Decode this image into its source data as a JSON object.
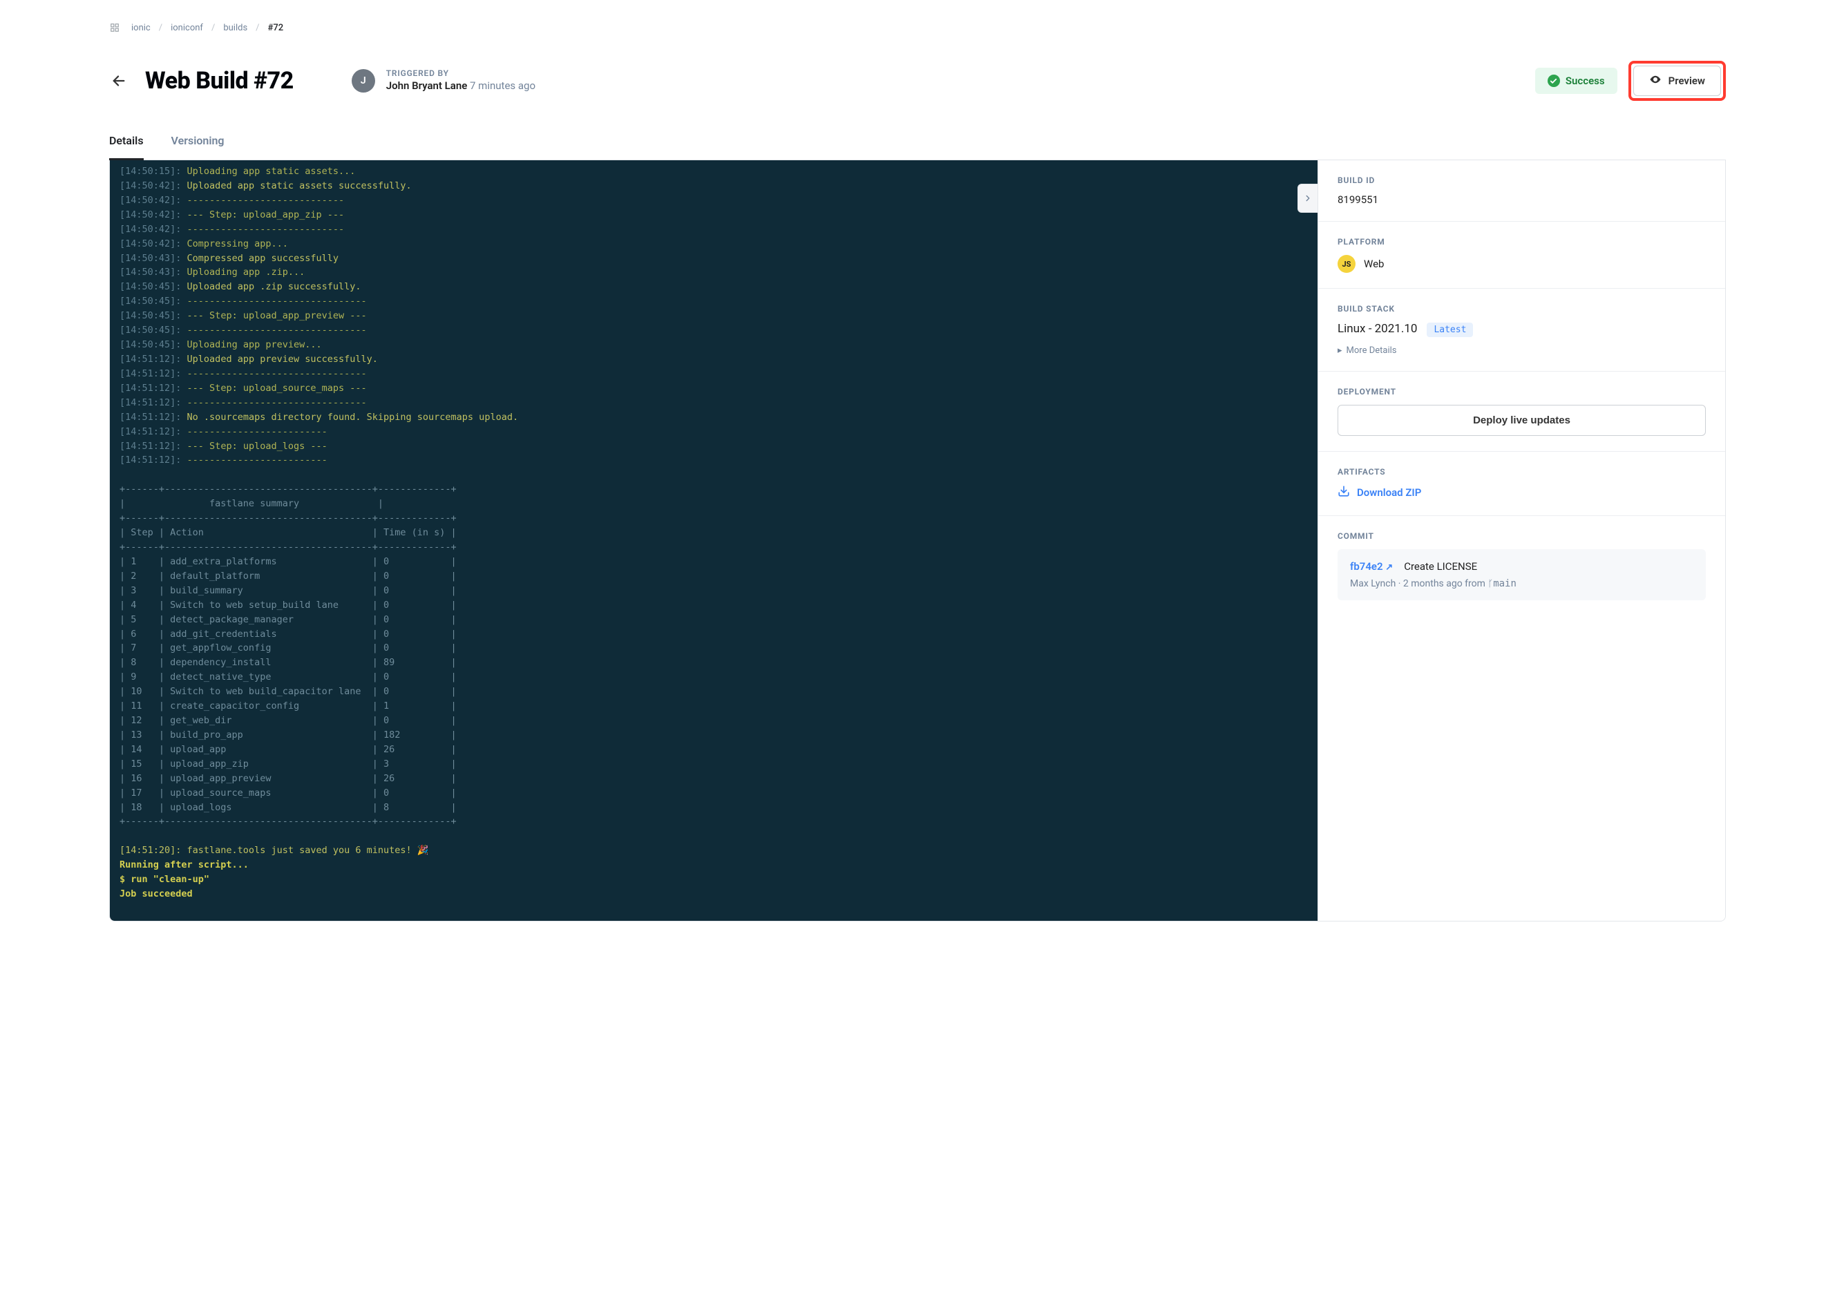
{
  "breadcrumb": {
    "org": "ionic",
    "project": "ioniconf",
    "section": "builds",
    "current": "#72"
  },
  "header": {
    "title": "Web Build #72",
    "triggered_by_label": "TRIGGERED BY",
    "triggered_by_name": "John Bryant Lane",
    "triggered_by_ago": "7 minutes ago",
    "avatar_initial": "J",
    "status": "Success",
    "preview_label": "Preview"
  },
  "tabs": {
    "details": "Details",
    "versioning": "Versioning"
  },
  "console": {
    "lines": [
      {
        "ts": "[14:50:15]:",
        "text": "Uploading app static assets...",
        "cls": "step"
      },
      {
        "ts": "[14:50:42]:",
        "text": "Uploaded app static assets successfully.",
        "cls": "ok"
      },
      {
        "ts": "[14:50:42]:",
        "text": "----------------------------",
        "cls": "dash"
      },
      {
        "ts": "[14:50:42]:",
        "text": "--- Step: upload_app_zip ---",
        "cls": "step"
      },
      {
        "ts": "[14:50:42]:",
        "text": "----------------------------",
        "cls": "dash"
      },
      {
        "ts": "[14:50:42]:",
        "text": "Compressing app...",
        "cls": "step"
      },
      {
        "ts": "[14:50:43]:",
        "text": "Compressed app successfully",
        "cls": "ok"
      },
      {
        "ts": "[14:50:43]:",
        "text": "Uploading app .zip...",
        "cls": "step"
      },
      {
        "ts": "[14:50:45]:",
        "text": "Uploaded app .zip successfully.",
        "cls": "ok"
      },
      {
        "ts": "[14:50:45]:",
        "text": "--------------------------------",
        "cls": "dash"
      },
      {
        "ts": "[14:50:45]:",
        "text": "--- Step: upload_app_preview ---",
        "cls": "step"
      },
      {
        "ts": "[14:50:45]:",
        "text": "--------------------------------",
        "cls": "dash"
      },
      {
        "ts": "[14:50:45]:",
        "text": "Uploading app preview...",
        "cls": "step"
      },
      {
        "ts": "[14:51:12]:",
        "text": "Uploaded app preview successfully.",
        "cls": "ok"
      },
      {
        "ts": "[14:51:12]:",
        "text": "--------------------------------",
        "cls": "dash"
      },
      {
        "ts": "[14:51:12]:",
        "text": "--- Step: upload_source_maps ---",
        "cls": "step"
      },
      {
        "ts": "[14:51:12]:",
        "text": "--------------------------------",
        "cls": "dash"
      },
      {
        "ts": "[14:51:12]:",
        "text": "No .sourcemaps directory found. Skipping sourcemaps upload.",
        "cls": "ok"
      },
      {
        "ts": "[14:51:12]:",
        "text": "-------------------------",
        "cls": "dash"
      },
      {
        "ts": "[14:51:12]:",
        "text": "--- Step: upload_logs ---",
        "cls": "step"
      },
      {
        "ts": "[14:51:12]:",
        "text": "-------------------------",
        "cls": "dash"
      }
    ],
    "summary_title": "fastlane summary",
    "summary_header": {
      "step": "Step",
      "action": "Action",
      "time": "Time (in s)"
    },
    "summary_rows": [
      {
        "n": "1",
        "action": "add_extra_platforms",
        "t": "0"
      },
      {
        "n": "2",
        "action": "default_platform",
        "t": "0"
      },
      {
        "n": "3",
        "action": "build_summary",
        "t": "0"
      },
      {
        "n": "4",
        "action": "Switch to web setup_build lane",
        "t": "0"
      },
      {
        "n": "5",
        "action": "detect_package_manager",
        "t": "0"
      },
      {
        "n": "6",
        "action": "add_git_credentials",
        "t": "0"
      },
      {
        "n": "7",
        "action": "get_appflow_config",
        "t": "0"
      },
      {
        "n": "8",
        "action": "dependency_install",
        "t": "89"
      },
      {
        "n": "9",
        "action": "detect_native_type",
        "t": "0"
      },
      {
        "n": "10",
        "action": "Switch to web build_capacitor lane",
        "t": "0"
      },
      {
        "n": "11",
        "action": "create_capacitor_config",
        "t": "1"
      },
      {
        "n": "12",
        "action": "get_web_dir",
        "t": "0"
      },
      {
        "n": "13",
        "action": "build_pro_app",
        "t": "182"
      },
      {
        "n": "14",
        "action": "upload_app",
        "t": "26"
      },
      {
        "n": "15",
        "action": "upload_app_zip",
        "t": "3"
      },
      {
        "n": "16",
        "action": "upload_app_preview",
        "t": "26"
      },
      {
        "n": "17",
        "action": "upload_source_maps",
        "t": "0"
      },
      {
        "n": "18",
        "action": "upload_logs",
        "t": "8"
      }
    ],
    "footer_saved": "[14:51:20]: fastlane.tools just saved you 6 minutes! 🎉",
    "footer_after": "Running after script...",
    "footer_run": "$ run \"clean-up\"",
    "footer_done": "Job succeeded"
  },
  "sidebar": {
    "build_id_label": "BUILD ID",
    "build_id": "8199551",
    "platform_label": "PLATFORM",
    "platform_value": "Web",
    "js_badge": "JS",
    "stack_label": "BUILD STACK",
    "stack_value": "Linux - 2021.10",
    "stack_latest": "Latest",
    "more_details": "More Details",
    "deployment_label": "DEPLOYMENT",
    "deploy_button": "Deploy live updates",
    "artifacts_label": "ARTIFACTS",
    "download_zip": "Download ZIP",
    "commit_label": "COMMIT",
    "commit_hash": "fb74e2",
    "commit_msg": "Create LICENSE",
    "commit_author": "Max Lynch",
    "commit_ago": "2 months ago from",
    "commit_branch": "main"
  }
}
